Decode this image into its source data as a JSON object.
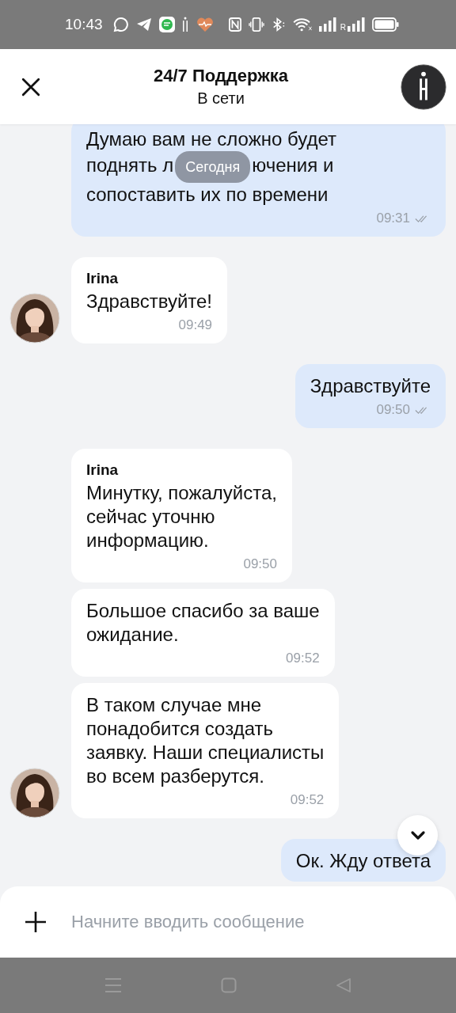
{
  "status_bar": {
    "time": "10:43",
    "roaming_label": "R"
  },
  "header": {
    "title": "24/7 Поддержка",
    "subtitle": "В сети"
  },
  "date_pill": "Сегодня",
  "messages": [
    {
      "kind": "out",
      "lines": [
        [
          "Думаю вам не сложно будет"
        ],
        [
          "поднять л",
          "ючения и"
        ],
        [
          "сопоставить их по времени"
        ]
      ],
      "time": "09:31",
      "read": true
    },
    {
      "kind": "in",
      "sender": "Irina",
      "text": "Здравствуйте!",
      "time": "09:49",
      "avatar": true
    },
    {
      "kind": "out",
      "text": "Здравствуйте",
      "time": "09:50",
      "read": true
    },
    {
      "kind": "in",
      "sender": "Irina",
      "text": "Минутку, пожалуйста,\nсейчас уточню\nинформацию.",
      "time": "09:50",
      "avatar": false
    },
    {
      "kind": "in",
      "text": "Большое спасибо за ваше\nожидание.",
      "time": "09:52",
      "avatar": false
    },
    {
      "kind": "in",
      "text": "В таком случае мне\nпонадобится создать\nзаявку. Наши специалисты\nво всем разберутся.",
      "time": "09:52",
      "avatar": true
    },
    {
      "kind": "out",
      "text": "Ок. Жду ответа"
    }
  ],
  "composer": {
    "placeholder": "Начните вводить сообщение"
  }
}
